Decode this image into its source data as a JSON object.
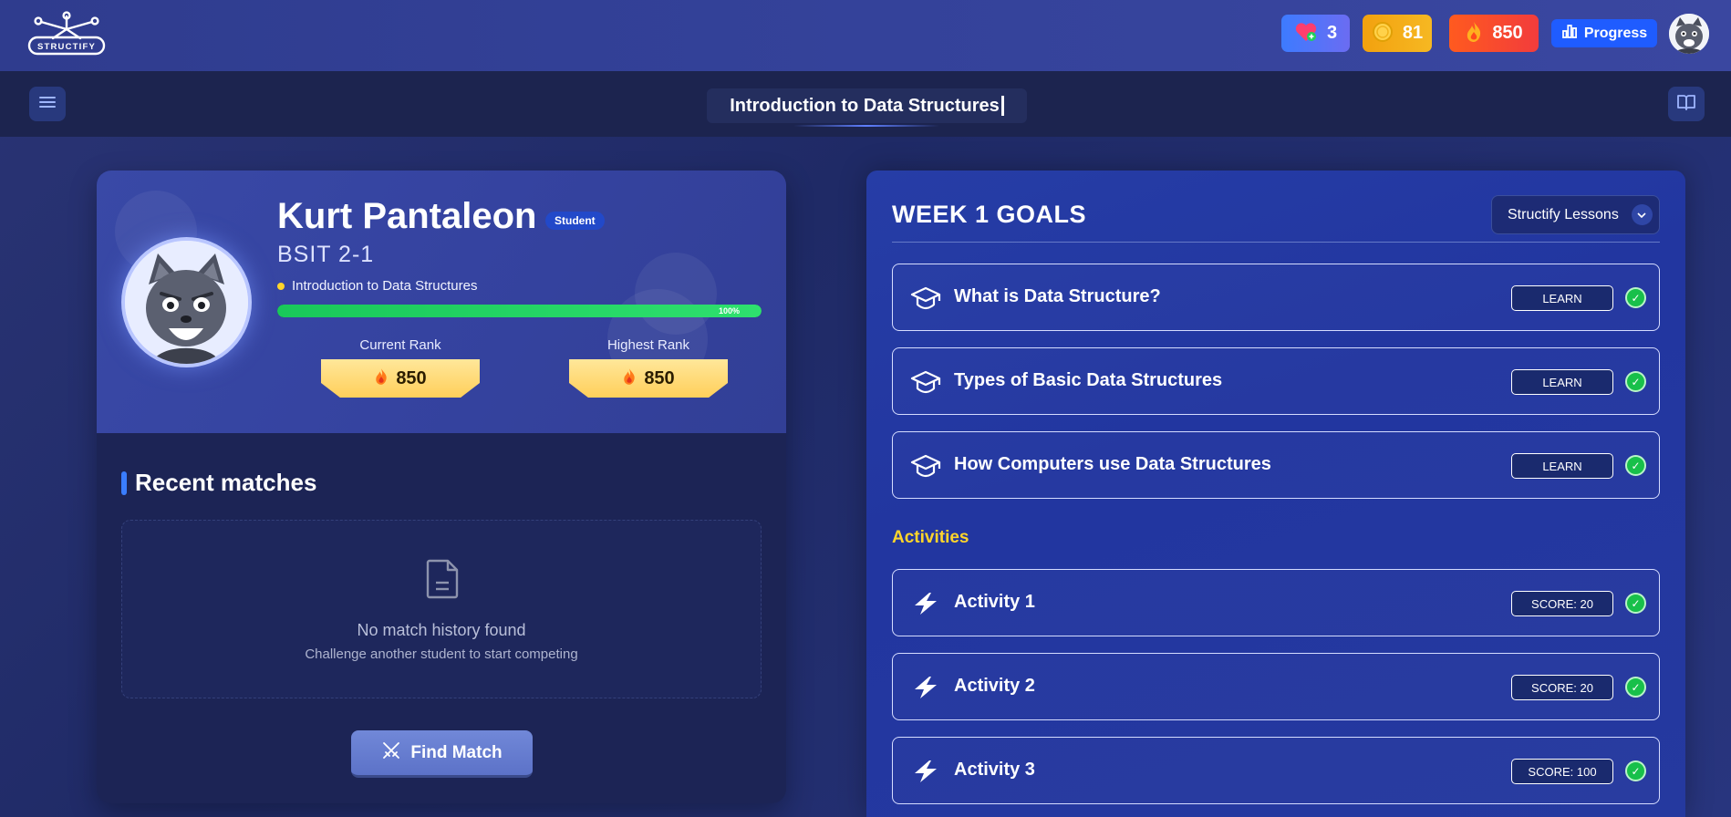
{
  "topbar": {
    "logo_text": "STRUCTIFY",
    "hearts": "3",
    "coins": "81",
    "streak": "850",
    "progress_label": "Progress"
  },
  "subbar": {
    "course_title": "Introduction to Data Structures"
  },
  "profile": {
    "name": "Kurt Pantaleon",
    "role": "Student",
    "section": "BSIT 2-1",
    "course": "Introduction to Data Structures",
    "progress_percent": 100,
    "progress_label": "100%",
    "current_rank_label": "Current Rank",
    "current_rank_value": "850",
    "highest_rank_label": "Highest Rank",
    "highest_rank_value": "850"
  },
  "recent_matches": {
    "title": "Recent matches",
    "empty_title": "No match history found",
    "empty_subtitle": "Challenge another student to start competing",
    "find_match_label": "Find Match"
  },
  "goals": {
    "week_title": "WEEK 1 GOALS",
    "lesson_select": "Structify Lessons",
    "lessons": [
      {
        "label": "What is Data Structure?",
        "button": "LEARN"
      },
      {
        "label": "Types of Basic Data Structures",
        "button": "LEARN"
      },
      {
        "label": "How Computers use Data Structures",
        "button": "LEARN"
      }
    ],
    "activities_label": "Activities",
    "activities": [
      {
        "label": "Activity 1",
        "button": "SCORE: 20"
      },
      {
        "label": "Activity 2",
        "button": "SCORE: 20"
      },
      {
        "label": "Activity 3",
        "button": "SCORE: 100"
      }
    ]
  },
  "colors": {
    "accent": "#1f5cff",
    "activities": "#ffd52b",
    "check": "#18c04a"
  }
}
